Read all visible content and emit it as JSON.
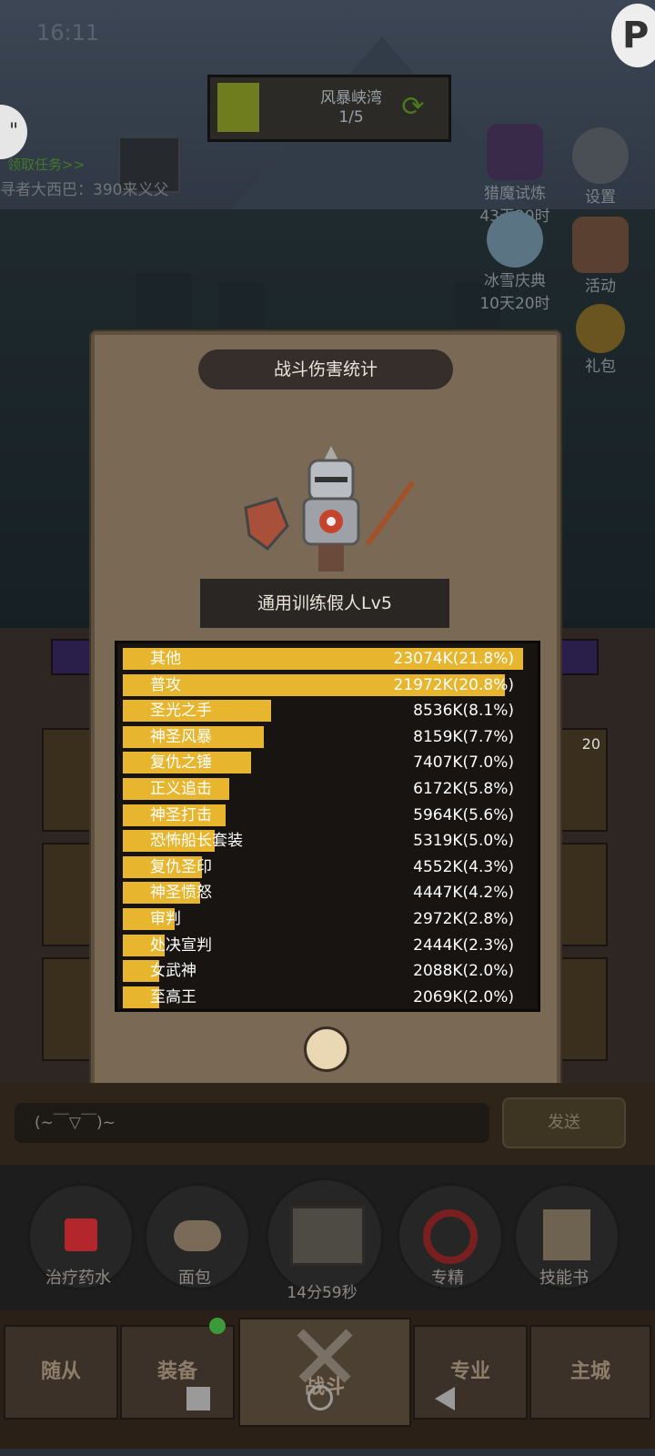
{
  "status_bar": {
    "time": "16:11"
  },
  "task": {
    "title": "风暴峡湾",
    "progress": "1/5"
  },
  "quest": {
    "link": "领取任务>>",
    "text": "寻者大西巴：390来义父"
  },
  "right_menu": [
    {
      "label": "猎魔试炼",
      "sub": "43天20时",
      "icon": "bat-wing-icon"
    },
    {
      "label": "设置",
      "sub": "",
      "icon": "gear-icon"
    },
    {
      "label": "冰雪庆典",
      "sub": "10天20时",
      "icon": "snowflake-icon"
    },
    {
      "label": "活动",
      "sub": "",
      "icon": "calendar-icon"
    },
    {
      "label": "礼包",
      "sub": "",
      "icon": "gift-coin-icon"
    }
  ],
  "side_badge": "20",
  "modal": {
    "title": "战斗伤害统计",
    "target_name": "通用训练假人Lv5"
  },
  "damage_stats": [
    {
      "name": "其他",
      "value": "23074K(21.8%)",
      "percent": 21.8
    },
    {
      "name": "普攻",
      "value": "21972K(20.8%)",
      "percent": 20.8
    },
    {
      "name": "圣光之手",
      "value": "8536K(8.1%)",
      "percent": 8.1
    },
    {
      "name": "神圣风暴",
      "value": "8159K(7.7%)",
      "percent": 7.7
    },
    {
      "name": "复仇之锤",
      "value": "7407K(7.0%)",
      "percent": 7.0
    },
    {
      "name": "正义追击",
      "value": "6172K(5.8%)",
      "percent": 5.8
    },
    {
      "name": "神圣打击",
      "value": "5964K(5.6%)",
      "percent": 5.6
    },
    {
      "name": "恐怖船长套装",
      "value": "5319K(5.0%)",
      "percent": 5.0
    },
    {
      "name": "复仇圣印",
      "value": "4552K(4.3%)",
      "percent": 4.3
    },
    {
      "name": "神圣愤怒",
      "value": "4447K(4.2%)",
      "percent": 4.2
    },
    {
      "name": "审判",
      "value": "2972K(2.8%)",
      "percent": 2.8
    },
    {
      "name": "处决宣判",
      "value": "2444K(2.3%)",
      "percent": 2.3
    },
    {
      "name": "女武神",
      "value": "2088K(2.0%)",
      "percent": 2.0
    },
    {
      "name": "至高王",
      "value": "2069K(2.0%)",
      "percent": 2.0
    }
  ],
  "chat": {
    "placeholder": "(~￣▽￣)~",
    "send": "发送"
  },
  "items": [
    {
      "label": "治疗药水",
      "icon": "potion-icon"
    },
    {
      "label": "面包",
      "icon": "bread-icon"
    },
    {
      "label": "14分59秒",
      "icon": "treasure-chest-icon"
    },
    {
      "label": "专精",
      "icon": "specialization-icon"
    },
    {
      "label": "技能书",
      "icon": "skill-book-icon"
    }
  ],
  "bottom_nav": [
    {
      "label": "随从"
    },
    {
      "label": "装备"
    },
    {
      "label": "战斗"
    },
    {
      "label": "专业"
    },
    {
      "label": "主城"
    }
  ],
  "colors": {
    "bar": "#e8b52f",
    "modal_bg": "#7a6a55",
    "panel_bg": "#171412"
  }
}
